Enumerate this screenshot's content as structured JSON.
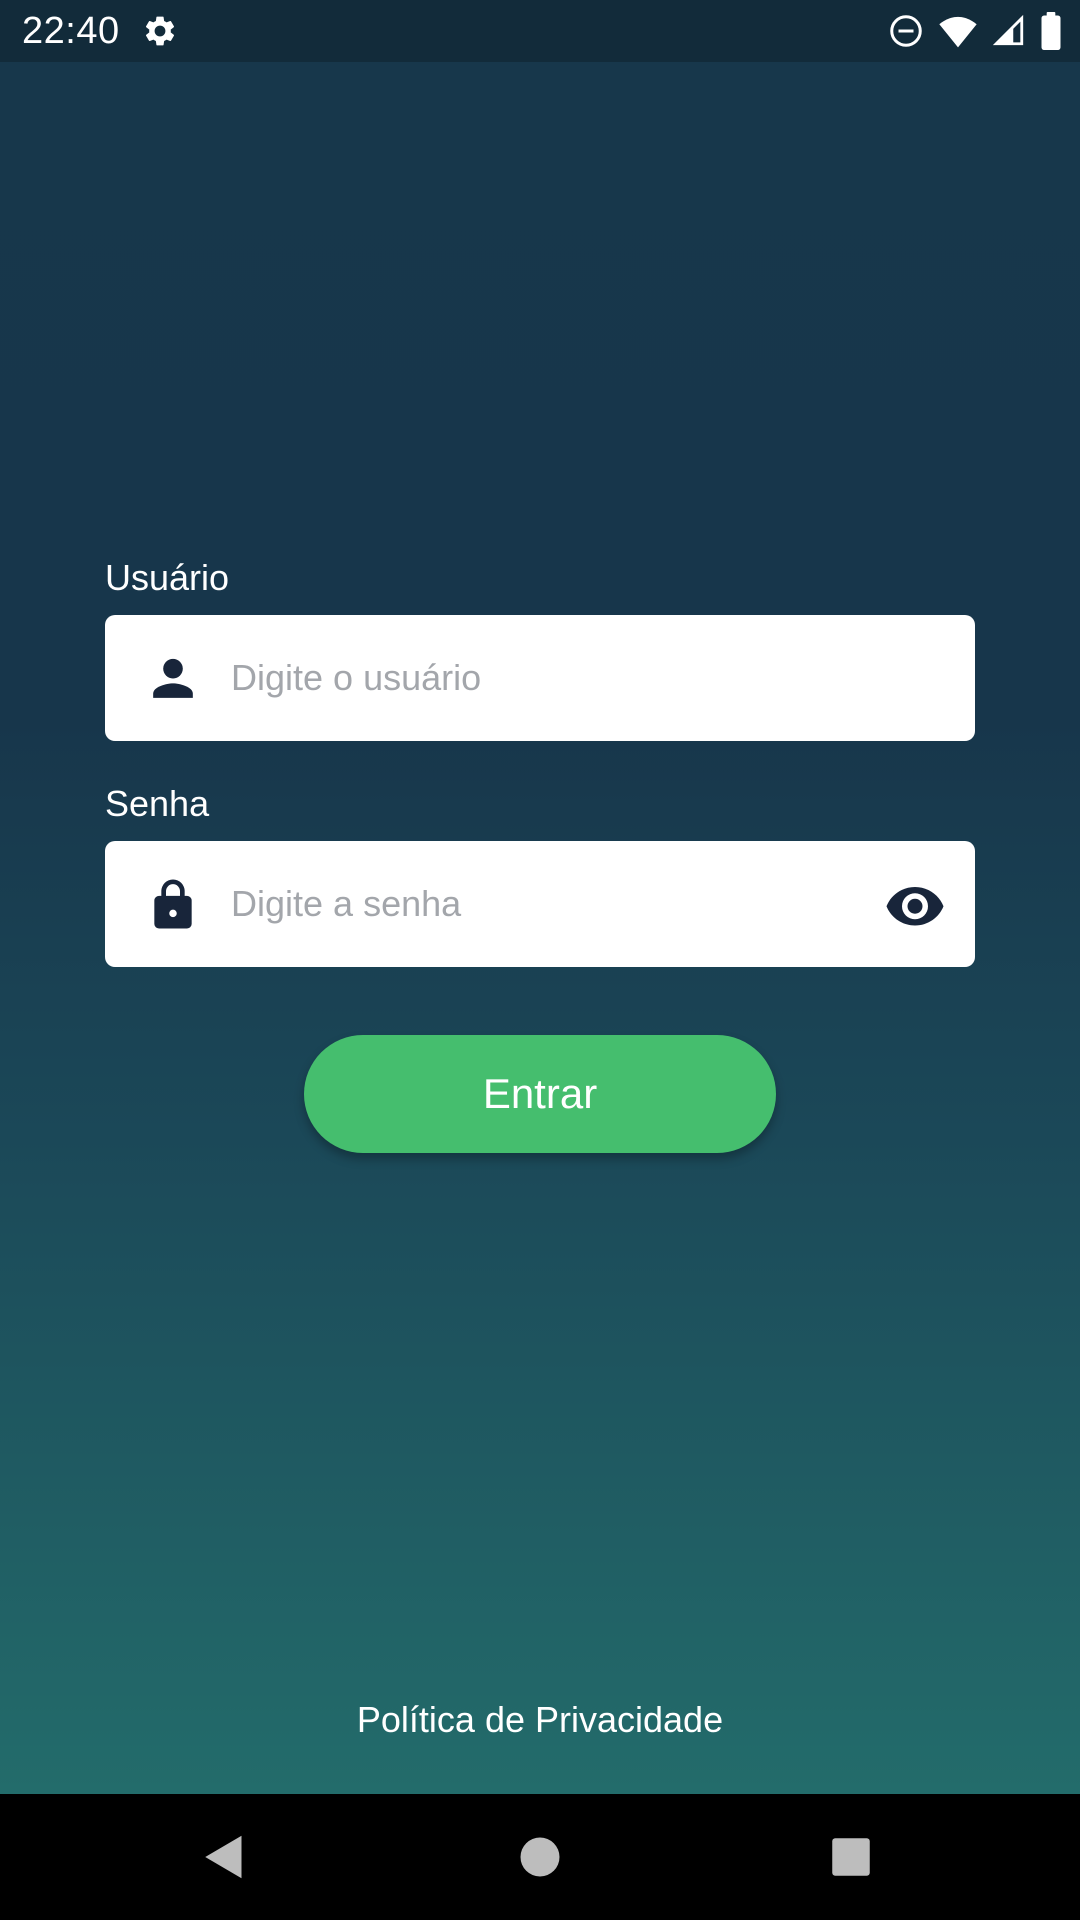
{
  "status_bar": {
    "time": "22:40",
    "icons": [
      "gear-icon",
      "do-not-disturb-icon",
      "wifi-icon",
      "signal-icon",
      "battery-icon"
    ]
  },
  "login_form": {
    "username": {
      "label": "Usuário",
      "placeholder": "Digite o usuário",
      "value": "",
      "icon": "person-icon"
    },
    "password": {
      "label": "Senha",
      "placeholder": "Digite a senha",
      "value": "",
      "icon": "lock-icon",
      "toggle_icon": "eye-icon"
    },
    "submit_label": "Entrar"
  },
  "footer": {
    "privacy_label": "Política de Privacidade"
  },
  "navigation_bar": {
    "buttons": [
      "back-icon",
      "home-icon",
      "recents-icon"
    ]
  },
  "colors": {
    "status_bar": "#122b3a",
    "background_top": "#17374b",
    "background_bottom": "#236c6b",
    "button": "#45be6e",
    "icon_dark": "#18253a",
    "placeholder": "#a3a6ab"
  }
}
